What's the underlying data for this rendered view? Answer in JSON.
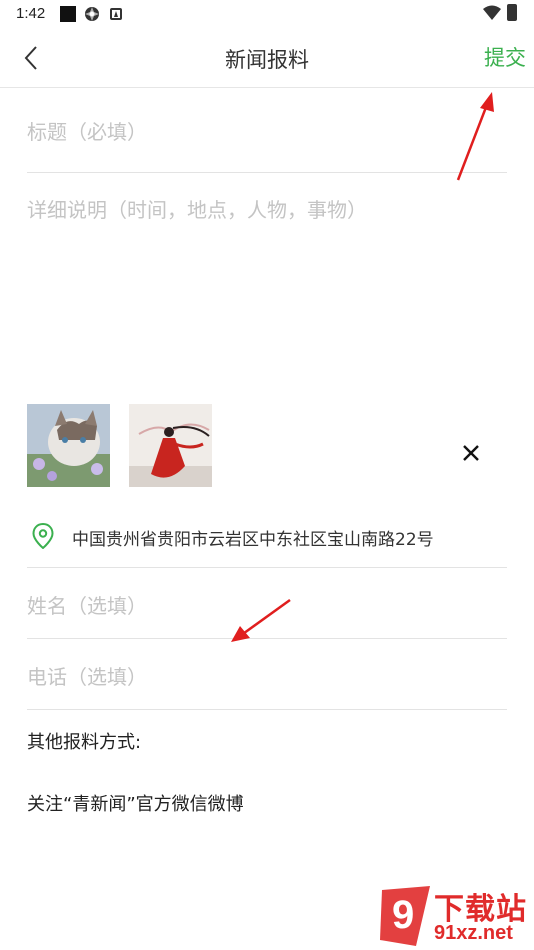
{
  "status_bar": {
    "time": "1:42",
    "icons": [
      "square-icon",
      "gear-icon",
      "a-icon",
      "wifi-icon",
      "battery-icon"
    ]
  },
  "header": {
    "title": "新闻报料",
    "submit_label": "提交",
    "back_icon": "chevron-left-icon"
  },
  "form": {
    "title_placeholder": "标题（必填）",
    "detail_placeholder": "详细说明（时间，地点，人物，事物）",
    "name_placeholder": "姓名（选填）",
    "phone_placeholder": "电话（选填）"
  },
  "attachments": {
    "images": [
      "cat-photo",
      "red-dress-woman-photo"
    ],
    "remove_icon": "close-icon"
  },
  "location": {
    "icon": "location-pin-icon",
    "address": "中国贵州省贵阳市云岩区中东社区宝山南路22号"
  },
  "other_channels": {
    "title": "其他报料方式:",
    "follow_text": "关注“青新闻”官方微信微博"
  },
  "watermark": {
    "logo_text": "9",
    "line1": "下载站",
    "line2": "91xz.net"
  },
  "colors": {
    "accent": "#3bb04f",
    "placeholder": "#c4c4c4",
    "divider": "#e3e3e3",
    "annotation": "#e01e1e",
    "watermark": "#e02b2b"
  }
}
